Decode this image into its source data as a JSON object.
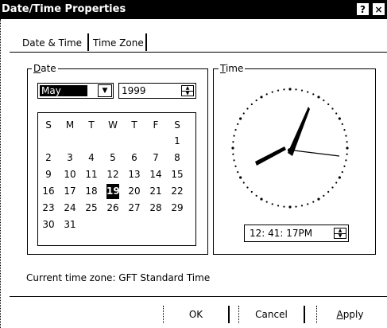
{
  "window": {
    "title": "Date/Time Properties",
    "help_glyph": "?",
    "close_glyph": "×"
  },
  "tabs": [
    {
      "label": "Date & Time"
    },
    {
      "label": "Time Zone"
    }
  ],
  "date_group": {
    "legend_ul": "D",
    "legend_rest": "ate"
  },
  "time_group": {
    "legend_ul": "T",
    "legend_rest": "ime"
  },
  "month": {
    "selected": "May",
    "arrow": "▼"
  },
  "year": {
    "value": "1999",
    "up": "▲",
    "down": "▼"
  },
  "calendar": {
    "weekdays": [
      "S",
      "M",
      "T",
      "W",
      "T",
      "F",
      "S"
    ],
    "weeks": [
      [
        "",
        "",
        "",
        "",
        "",
        "",
        "1"
      ],
      [
        "2",
        "3",
        "4",
        "5",
        "6",
        "7",
        "8"
      ],
      [
        "9",
        "10",
        "11",
        "12",
        "13",
        "14",
        "15"
      ],
      [
        "16",
        "17",
        "18",
        "19",
        "20",
        "21",
        "22"
      ],
      [
        "23",
        "24",
        "25",
        "26",
        "27",
        "28",
        "29"
      ],
      [
        "30",
        "31",
        "",
        "",
        "",
        "",
        ""
      ]
    ],
    "selected_day": "19"
  },
  "time": {
    "value": "12: 41: 17PM",
    "up": "▲",
    "down": "▼"
  },
  "current_time_zone": "Current time zone:  GFT Standard Time",
  "buttons": {
    "ok": "OK",
    "cancel": "Cancel",
    "apply_ul": "A",
    "apply_rest": "pply"
  }
}
